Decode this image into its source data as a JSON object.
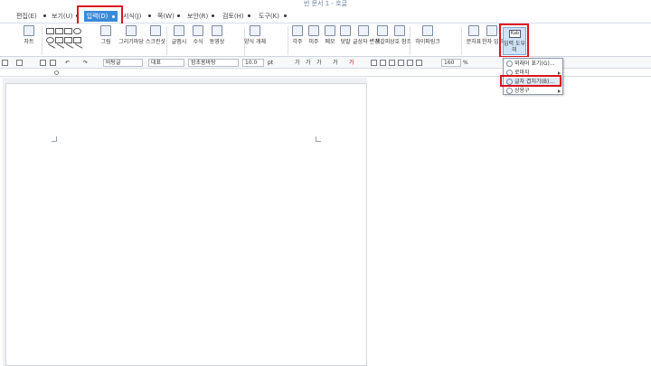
{
  "window": {
    "title": "빈 문서 1 - 호글"
  },
  "menubar": {
    "items": [
      {
        "label": "편집(E)"
      },
      {
        "label": "보기(U)"
      },
      {
        "label": "입력(D)"
      },
      {
        "label": "서식(J)"
      },
      {
        "label": "쪽(W)"
      },
      {
        "label": "보안(R)"
      },
      {
        "label": "검토(H)"
      },
      {
        "label": "도구(K)"
      }
    ],
    "active": "입력(D)"
  },
  "ribbon": {
    "chart": "차트",
    "picture": "그림",
    "draw": "그리기마당",
    "scan": "스크린샷",
    "caption": "글맵시",
    "formula": "수식",
    "video": "동영상",
    "fold": "양식 개체",
    "memo1": "각주",
    "memo2": "미주",
    "memo3": "메모",
    "comment": "덧말",
    "field": "글상자 변경",
    "bookmark": "책갈피",
    "cross": "상호 참조",
    "hyperlink": "하이퍼링크",
    "symbol": "문자표",
    "hanja": "한자 입력",
    "input_tool": "입력 도우미",
    "input_tool_icon": "Kab"
  },
  "formatbar": {
    "style": "바탕글",
    "lang": "대표",
    "font": "함초롬바탕",
    "size": "10.0",
    "size_unit": "pt",
    "zoom": "160",
    "zoom_unit": "%"
  },
  "dropdown": {
    "items": [
      {
        "label": "외래어 표기(G)...",
        "has_sub": false
      },
      {
        "label": "로마자",
        "has_sub": true
      },
      {
        "label": "글자 겹치기(B)...",
        "has_sub": false,
        "highlighted": true
      },
      {
        "label": "상용구",
        "has_sub": true
      }
    ]
  }
}
